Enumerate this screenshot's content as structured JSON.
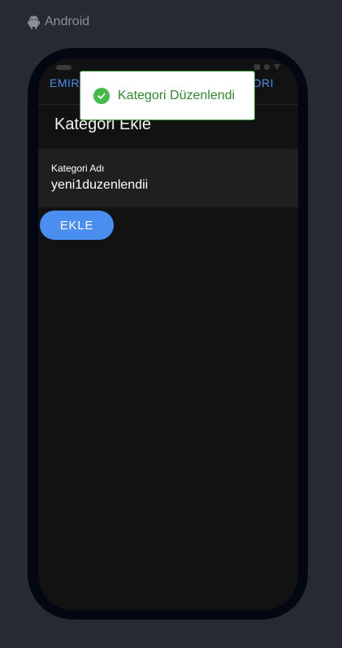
{
  "platform": {
    "label": "Android"
  },
  "tabs": {
    "left_label": "EMIR",
    "right_label": "ORI"
  },
  "page": {
    "title": "Kategori Ekle"
  },
  "form": {
    "category_label": "Kategori Adı",
    "category_value": "yeni1duzenlendii",
    "submit_label": "EKLE"
  },
  "toast": {
    "message": "Kategori Düzenlendi"
  },
  "colors": {
    "accent": "#4a8ff0",
    "success": "#45b94a",
    "background": "#262b33",
    "screen": "#121212"
  }
}
